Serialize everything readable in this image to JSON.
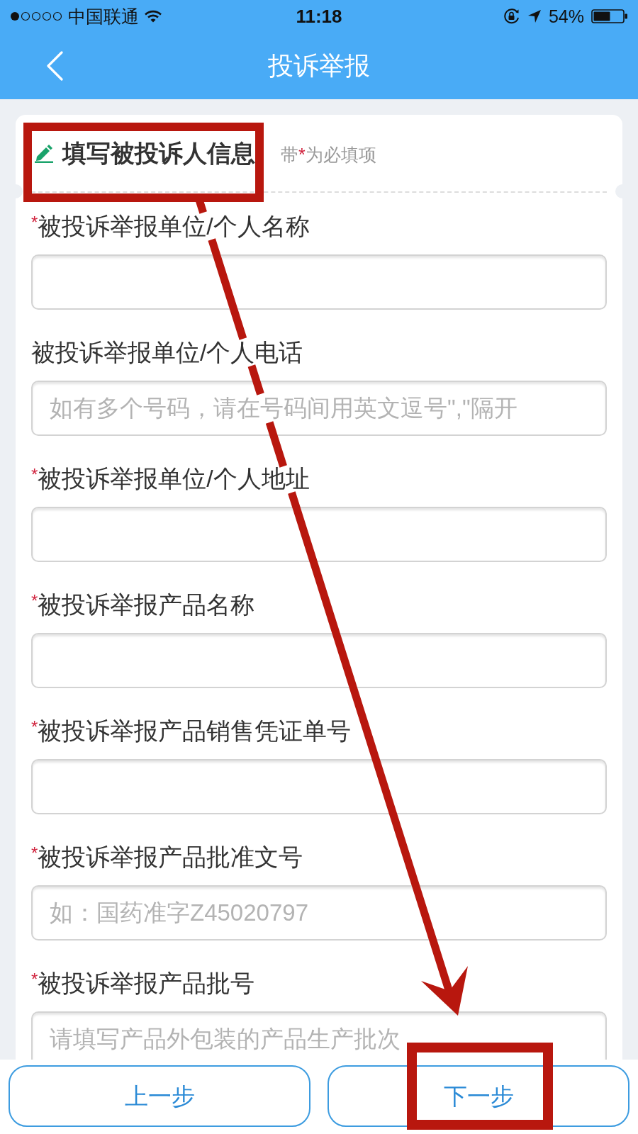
{
  "status_bar": {
    "carrier": "中国联通",
    "time": "11:18",
    "battery": "54%"
  },
  "nav": {
    "title": "投诉举报"
  },
  "section": {
    "title": "填写被投诉人信息",
    "hint": {
      "before": "带",
      "mark": "*",
      "after": "为必填项"
    }
  },
  "fields": [
    {
      "mark": "*",
      "label": "被投诉举报单位/个人名称"
    },
    {
      "label": "被投诉举报单位/个人电话",
      "placeholder": "如有多个号码，请在号码间用英文逗号\",\"隔开"
    },
    {
      "mark": "*",
      "label": "被投诉举报单位/个人地址"
    },
    {
      "mark": "*",
      "label": "被投诉举报产品名称"
    },
    {
      "mark": "*",
      "label": "被投诉举报产品销售凭证单号"
    },
    {
      "mark": "*",
      "label": "被投诉举报产品批准文号",
      "placeholder": "如：国药准字Z45020797"
    },
    {
      "mark": "*",
      "label": "被投诉举报产品批号",
      "placeholder": "请填写产品外包装的产品生产批次"
    }
  ],
  "buttons": [
    {
      "label": "上一步"
    },
    {
      "label": "下一步"
    }
  ]
}
